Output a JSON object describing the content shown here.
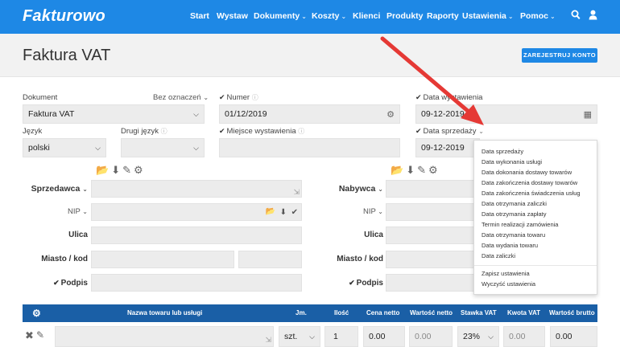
{
  "app": {
    "logo": "Fakturowo"
  },
  "nav": {
    "start": "Start",
    "wystaw": "Wystaw",
    "dokumenty": "Dokumenty",
    "koszty": "Koszty",
    "klienci": "Klienci",
    "produkty": "Produkty",
    "raporty": "Raporty",
    "ustawienia": "Ustawienia",
    "pomoc": "Pomoc"
  },
  "header": {
    "title": "Faktura VAT",
    "register_button": "ZAREJESTRUJ KONTO"
  },
  "form": {
    "dokument_label": "Dokument",
    "bez_oznaczen": "Bez oznaczeń",
    "dokument_value": "Faktura VAT",
    "numer_label": "Numer",
    "numer_value": "01/12/2019",
    "data_wystawienia_label": "Data wystawienia",
    "data_wystawienia_value": "09-12-2019",
    "jezyk_label": "Język",
    "jezyk_value": "polski",
    "drugi_jezyk_label": "Drugi język",
    "miejsce_label": "Miejsce wystawienia",
    "data_sprzedazy_label": "Data sprzedaży",
    "data_sprzedazy_value": "09-12-2019"
  },
  "seller": {
    "label": "Sprzedawca",
    "nip": "NIP",
    "ulica": "Ulica",
    "miasto": "Miasto / kod",
    "podpis": "Podpis"
  },
  "buyer": {
    "label": "Nabywca",
    "nip": "NIP",
    "ulica": "Ulica",
    "miasto": "Miasto / kod",
    "podpis": "Podpis"
  },
  "date_dropdown": {
    "items": [
      "Data sprzedaży",
      "Data wykonania usługi",
      "Data dokonania dostawy towarów",
      "Data zakończenia dostawy towarów",
      "Data zakończenia świadczenia usług",
      "Data otrzymania zaliczki",
      "Data otrzymania zapłaty",
      "Termin realizacji zamówienia",
      "Data otrzymania towaru",
      "Data wydania towaru",
      "Data zaliczki"
    ],
    "save": "Zapisz ustawienia",
    "clear": "Wyczyść ustawienia"
  },
  "table": {
    "columns": [
      "Nazwa towaru lub usługi",
      "Jm.",
      "Ilość",
      "Cena netto",
      "Wartość netto",
      "Stawka VAT",
      "Kwota VAT",
      "Wartość brutto"
    ],
    "row": {
      "jm": "szt.",
      "ilosc": "1",
      "cena_netto": "0.00",
      "wartosc_netto": "0.00",
      "stawka_vat": "23%",
      "kwota_vat": "0.00",
      "wartosc_brutto": "0.00"
    }
  },
  "colors": {
    "brand": "#1e88e5",
    "table_header": "#1a5fa6",
    "arrow": "#e53935"
  }
}
